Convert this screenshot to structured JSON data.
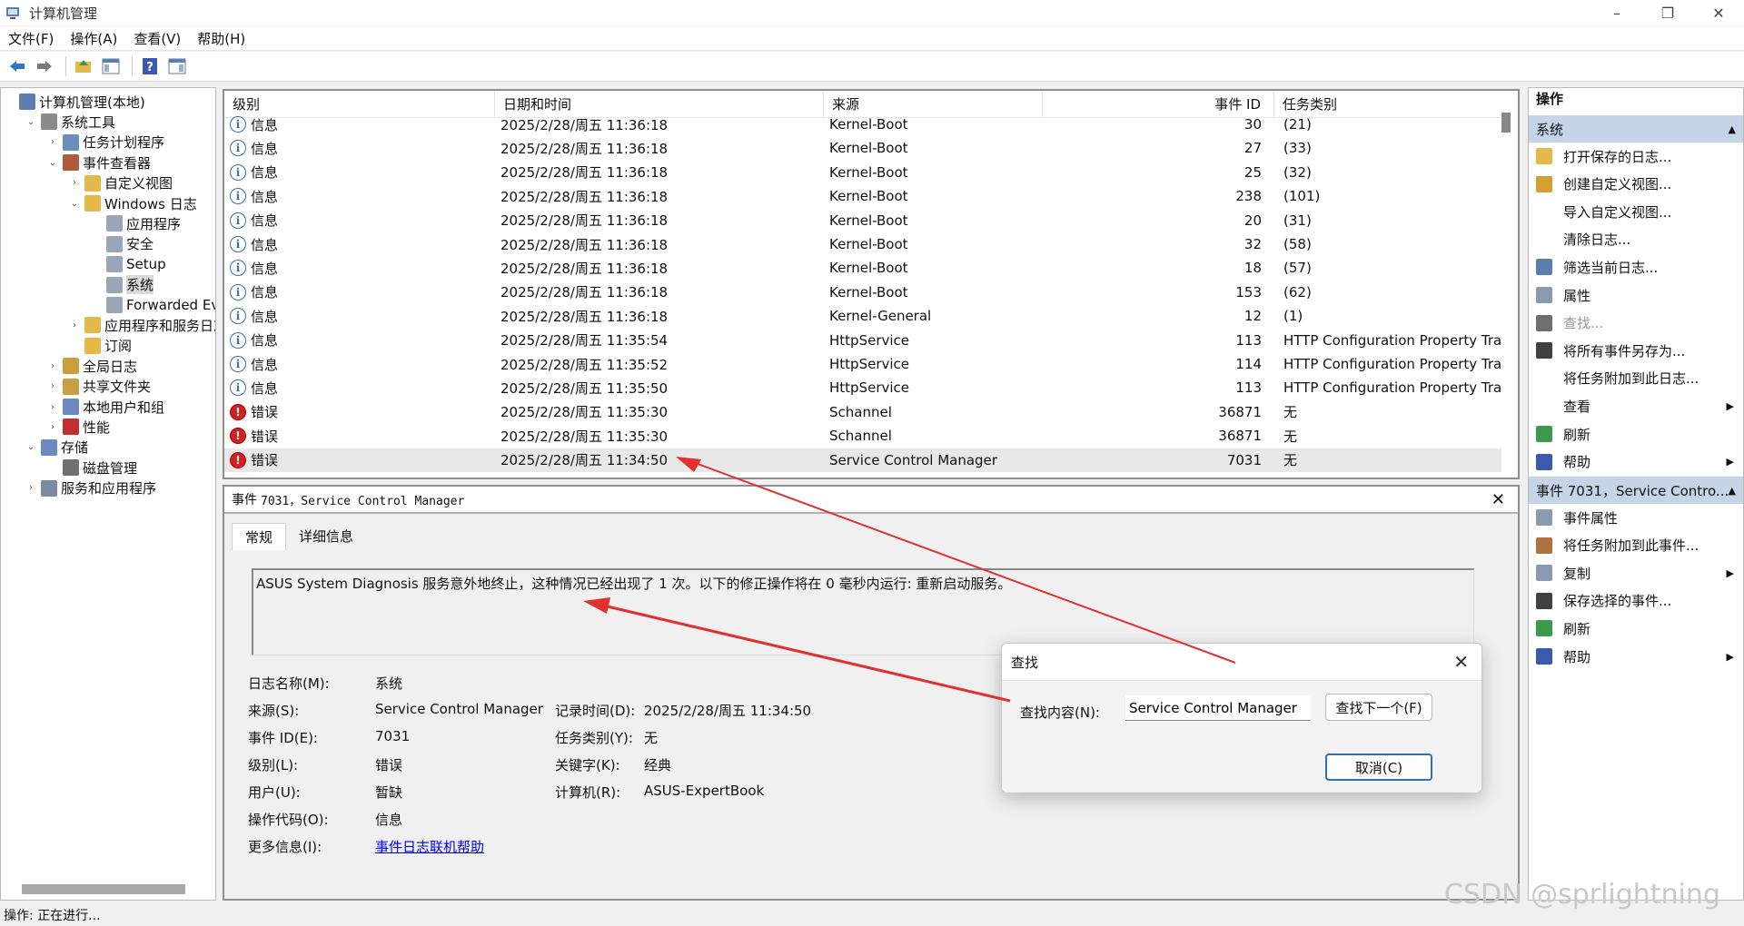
{
  "window": {
    "title": "计算机管理"
  },
  "menu": [
    "文件(F)",
    "操作(A)",
    "查看(V)",
    "帮助(H)"
  ],
  "tree": [
    {
      "label": "计算机管理(本地)",
      "level": 0,
      "expander": "",
      "icon": "computer-mgmt-icon",
      "color": "#5a7fb0"
    },
    {
      "label": "系统工具",
      "level": 1,
      "expander": "⌄",
      "icon": "system-tools-icon",
      "color": "#8a8a8a"
    },
    {
      "label": "任务计划程序",
      "level": 2,
      "expander": "›",
      "icon": "clock-icon",
      "color": "#6b8fb8"
    },
    {
      "label": "事件查看器",
      "level": 2,
      "expander": "⌄",
      "icon": "event-viewer-icon",
      "color": "#b05a3a"
    },
    {
      "label": "自定义视图",
      "level": 3,
      "expander": "›",
      "icon": "folder-icon",
      "color": "#e5b84a"
    },
    {
      "label": "Windows 日志",
      "level": 3,
      "expander": "⌄",
      "icon": "folder-icon",
      "color": "#e5b84a"
    },
    {
      "label": "应用程序",
      "level": 4,
      "expander": "",
      "icon": "log-icon",
      "color": "#9aa6b8"
    },
    {
      "label": "安全",
      "level": 4,
      "expander": "",
      "icon": "log-icon",
      "color": "#9aa6b8"
    },
    {
      "label": "Setup",
      "level": 4,
      "expander": "",
      "icon": "log-icon",
      "color": "#9aa6b8"
    },
    {
      "label": "系统",
      "level": 4,
      "expander": "",
      "icon": "log-icon",
      "color": "#9aa6b8",
      "selected": true
    },
    {
      "label": "Forwarded Even",
      "level": 4,
      "expander": "",
      "icon": "log-icon",
      "color": "#9aa6b8"
    },
    {
      "label": "应用程序和服务日志",
      "level": 3,
      "expander": "›",
      "icon": "folder-icon",
      "color": "#e5b84a"
    },
    {
      "label": "订阅",
      "level": 3,
      "expander": "",
      "icon": "subscription-icon",
      "color": "#e5b84a"
    },
    {
      "label": "全局日志",
      "level": 2,
      "expander": "›",
      "icon": "shared-folder-icon",
      "color": "#c8a040"
    },
    {
      "label": "共享文件夹",
      "level": 2,
      "expander": "›",
      "icon": "shared-folder-icon",
      "color": "#c8a040"
    },
    {
      "label": "本地用户和组",
      "level": 2,
      "expander": "›",
      "icon": "users-icon",
      "color": "#6a8ac0"
    },
    {
      "label": "性能",
      "level": 2,
      "expander": "›",
      "icon": "performance-icon",
      "color": "#c03030"
    },
    {
      "label": "存储",
      "level": 1,
      "expander": "⌄",
      "icon": "storage-icon",
      "color": "#6a8ac0"
    },
    {
      "label": "磁盘管理",
      "level": 2,
      "expander": "",
      "icon": "disk-icon",
      "color": "#707070"
    },
    {
      "label": "服务和应用程序",
      "level": 1,
      "expander": "›",
      "icon": "services-icon",
      "color": "#7a8aa0"
    }
  ],
  "table": {
    "headers": [
      "级别",
      "日期和时间",
      "来源",
      "事件 ID",
      "任务类别"
    ],
    "rows": [
      {
        "level": "信息",
        "type": "info",
        "datetime": "2025/2/28/周五 11:36:18",
        "source": "Kernel-Boot",
        "id": "30",
        "category": "(21)"
      },
      {
        "level": "信息",
        "type": "info",
        "datetime": "2025/2/28/周五 11:36:18",
        "source": "Kernel-Boot",
        "id": "27",
        "category": "(33)"
      },
      {
        "level": "信息",
        "type": "info",
        "datetime": "2025/2/28/周五 11:36:18",
        "source": "Kernel-Boot",
        "id": "25",
        "category": "(32)"
      },
      {
        "level": "信息",
        "type": "info",
        "datetime": "2025/2/28/周五 11:36:18",
        "source": "Kernel-Boot",
        "id": "238",
        "category": "(101)"
      },
      {
        "level": "信息",
        "type": "info",
        "datetime": "2025/2/28/周五 11:36:18",
        "source": "Kernel-Boot",
        "id": "20",
        "category": "(31)"
      },
      {
        "level": "信息",
        "type": "info",
        "datetime": "2025/2/28/周五 11:36:18",
        "source": "Kernel-Boot",
        "id": "32",
        "category": "(58)"
      },
      {
        "level": "信息",
        "type": "info",
        "datetime": "2025/2/28/周五 11:36:18",
        "source": "Kernel-Boot",
        "id": "18",
        "category": "(57)"
      },
      {
        "level": "信息",
        "type": "info",
        "datetime": "2025/2/28/周五 11:36:18",
        "source": "Kernel-Boot",
        "id": "153",
        "category": "(62)"
      },
      {
        "level": "信息",
        "type": "info",
        "datetime": "2025/2/28/周五 11:36:18",
        "source": "Kernel-General",
        "id": "12",
        "category": "(1)"
      },
      {
        "level": "信息",
        "type": "info",
        "datetime": "2025/2/28/周五 11:35:54",
        "source": "HttpService",
        "id": "113",
        "category": "HTTP Configuration Property Tra..."
      },
      {
        "level": "信息",
        "type": "info",
        "datetime": "2025/2/28/周五 11:35:52",
        "source": "HttpService",
        "id": "114",
        "category": "HTTP Configuration Property Tra..."
      },
      {
        "level": "信息",
        "type": "info",
        "datetime": "2025/2/28/周五 11:35:50",
        "source": "HttpService",
        "id": "113",
        "category": "HTTP Configuration Property Tra..."
      },
      {
        "level": "错误",
        "type": "error",
        "datetime": "2025/2/28/周五 11:35:30",
        "source": "Schannel",
        "id": "36871",
        "category": "无"
      },
      {
        "level": "错误",
        "type": "error",
        "datetime": "2025/2/28/周五 11:35:30",
        "source": "Schannel",
        "id": "36871",
        "category": "无"
      },
      {
        "level": "错误",
        "type": "error",
        "datetime": "2025/2/28/周五 11:34:50",
        "source": "Service Control Manager",
        "id": "7031",
        "category": "无",
        "highlighted": true
      }
    ]
  },
  "detail": {
    "header_prefix": "事件",
    "header_rest": "7031，Service Control Manager",
    "tabs": [
      "常规",
      "详细信息"
    ],
    "message": "ASUS System Diagnosis 服务意外地终止，这种情况已经出现了 1 次。以下的修正操作将在 0 毫秒内运行: 重新启动服务。",
    "log_name_label": "日志名称(M):",
    "log_name": "系统",
    "source_label": "来源(S):",
    "source": "Service Control Manager",
    "logged_label": "记录时间(D):",
    "logged": "2025/2/28/周五 11:34:50",
    "event_id_label": "事件 ID(E):",
    "event_id": "7031",
    "task_cat_label": "任务类别(Y):",
    "task_cat": "无",
    "level_label": "级别(L):",
    "level": "错误",
    "keywords_label": "关键字(K):",
    "keywords": "经典",
    "user_label": "用户(U):",
    "user": "暂缺",
    "computer_label": "计算机(R):",
    "computer": "ASUS-ExpertBook",
    "opcode_label": "操作代码(O):",
    "opcode": "信息",
    "more_info_label": "更多信息(I):",
    "more_info_link": "事件日志联机帮助"
  },
  "actions": {
    "title": "操作",
    "section1": "系统",
    "items1": [
      {
        "label": "打开保存的日志...",
        "icon": "open-folder-icon",
        "color": "#e5b84a",
        "arrow": false,
        "disabled": false
      },
      {
        "label": "创建自定义视图...",
        "icon": "filter-icon",
        "color": "#d4a030",
        "arrow": false,
        "disabled": false
      },
      {
        "label": "导入自定义视图...",
        "icon": "",
        "color": "",
        "arrow": false,
        "disabled": false
      },
      {
        "label": "清除日志...",
        "icon": "",
        "color": "",
        "arrow": false,
        "disabled": false
      },
      {
        "label": "筛选当前日志...",
        "icon": "filter-icon",
        "color": "#5a7fb0",
        "arrow": false,
        "disabled": false
      },
      {
        "label": "属性",
        "icon": "properties-icon",
        "color": "#8a9ab0",
        "arrow": false,
        "disabled": false
      },
      {
        "label": "查找...",
        "icon": "binoculars-icon",
        "color": "#707070",
        "arrow": false,
        "disabled": true
      },
      {
        "label": "将所有事件另存为...",
        "icon": "save-icon",
        "color": "#404040",
        "arrow": false,
        "disabled": false
      },
      {
        "label": "将任务附加到此日志...",
        "icon": "",
        "color": "",
        "arrow": false,
        "disabled": false
      },
      {
        "label": "查看",
        "icon": "",
        "color": "",
        "arrow": true,
        "disabled": false
      },
      {
        "label": "刷新",
        "icon": "refresh-icon",
        "color": "#3a9a4a",
        "arrow": false,
        "disabled": false
      },
      {
        "label": "帮助",
        "icon": "help-icon",
        "color": "#3a5ab0",
        "arrow": true,
        "disabled": false
      }
    ],
    "section2": "事件 7031，Service Contro...",
    "items2": [
      {
        "label": "事件属性",
        "icon": "properties-icon",
        "color": "#8a9ab0",
        "arrow": false,
        "disabled": false
      },
      {
        "label": "将任务附加到此事件...",
        "icon": "task-icon",
        "color": "#b07040",
        "arrow": false,
        "disabled": false
      },
      {
        "label": "复制",
        "icon": "copy-icon",
        "color": "#8a9ab0",
        "arrow": true,
        "disabled": false
      },
      {
        "label": "保存选择的事件...",
        "icon": "save-icon",
        "color": "#404040",
        "arrow": false,
        "disabled": false
      },
      {
        "label": "刷新",
        "icon": "refresh-icon",
        "color": "#3a9a4a",
        "arrow": false,
        "disabled": false
      },
      {
        "label": "帮助",
        "icon": "help-icon",
        "color": "#3a5ab0",
        "arrow": true,
        "disabled": false
      }
    ]
  },
  "find_dialog": {
    "title": "查找",
    "label": "查找内容(N):",
    "value": "Service Control Manager",
    "find_next": "查找下一个(F)",
    "cancel": "取消(C)"
  },
  "status": "操作: 正在进行...",
  "watermark": "CSDN @sprlightning",
  "colors": {
    "accent": "#2f6fc0",
    "error": "#d32020",
    "arrow": "#e03030",
    "section": "#c5d4e6"
  }
}
